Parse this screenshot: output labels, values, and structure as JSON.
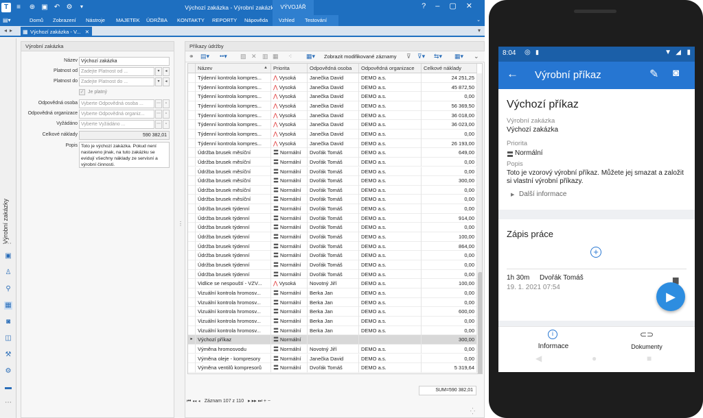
{
  "desktop": {
    "window_title": "Výchozí zakázka - Výrobní zakázka - TechIS",
    "context_tab": "VÝVOJÁŘ",
    "menu": [
      "Domů",
      "Zobrazení",
      "Nástroje",
      "MAJETEK",
      "ÚDRŽBA",
      "KONTAKTY",
      "REPORTY",
      "Nápověda",
      "Vzhled",
      "Testování"
    ],
    "document_tab": "Výchozí zakázka - V...",
    "left_rail_label": "Výrobní zakázky",
    "form": {
      "header": "Výrobní zakázka",
      "fields": {
        "nazev": {
          "label": "Název",
          "value": "Výchozí zakázka"
        },
        "platnost_od": {
          "label": "Platnost od",
          "placeholder": "Zadejte Platnost od ..."
        },
        "platnost_do": {
          "label": "Platnost do",
          "placeholder": "Zadejte Platnost do ..."
        },
        "je_platny": {
          "label": "Je platný"
        },
        "odp_osoba": {
          "label": "Odpovědná osoba",
          "placeholder": "Vyberte Odpovědná osoba ..."
        },
        "odp_org": {
          "label": "Odpovědná organizace",
          "placeholder": "Vyberte Odpovědná organiz..."
        },
        "vyzadano": {
          "label": "Vyžádáno",
          "placeholder": "Vyberte Vyžádáno ..."
        },
        "celkove": {
          "label": "Celkové náklady",
          "value": "590 382,01"
        },
        "popis": {
          "label": "Popis",
          "value": "Toto je výchozí zakázka. Pokud není nastaveno jinak, na tuto zakázku se evidují všechny náklady ze servisní a výrobní činnosti."
        }
      }
    },
    "grid": {
      "header": "Příkazy údržby",
      "toolbar_label": "Zobrazit modifikované záznamy",
      "columns": [
        "Název",
        "Priorita",
        "Odpovědná osoba",
        "Odpovědná organizace",
        "Celkové náklady"
      ],
      "rows": [
        [
          "Týdenní kontrola kompres...",
          "Vysoká",
          "Janečka David",
          "DEMO a.s.",
          "24 251,25"
        ],
        [
          "Týdenní kontrola kompres...",
          "Vysoká",
          "Janečka David",
          "DEMO a.s.",
          "45 872,50"
        ],
        [
          "Týdenní kontrola kompres...",
          "Vysoká",
          "Janečka David",
          "DEMO a.s.",
          "0,00"
        ],
        [
          "Týdenní kontrola kompres...",
          "Vysoká",
          "Janečka David",
          "DEMO a.s.",
          "56 369,50"
        ],
        [
          "Týdenní kontrola kompres...",
          "Vysoká",
          "Janečka David",
          "DEMO a.s.",
          "36 018,00"
        ],
        [
          "Týdenní kontrola kompres...",
          "Vysoká",
          "Janečka David",
          "DEMO a.s.",
          "36 023,00"
        ],
        [
          "Týdenní kontrola kompres...",
          "Vysoká",
          "Janečka David",
          "DEMO a.s.",
          "0,00"
        ],
        [
          "Týdenní kontrola kompres...",
          "Vysoká",
          "Janečka David",
          "DEMO a.s.",
          "26 193,00"
        ],
        [
          "Údržba brusek měsíční",
          "Normální",
          "Dvořák Tomáš",
          "DEMO a.s.",
          "649,00"
        ],
        [
          "Údržba brusek měsíční",
          "Normální",
          "Dvořák Tomáš",
          "DEMO a.s.",
          "0,00"
        ],
        [
          "Údržba brusek měsíční",
          "Normální",
          "Dvořák Tomáš",
          "DEMO a.s.",
          "0,00"
        ],
        [
          "Údržba brusek měsíční",
          "Normální",
          "Dvořák Tomáš",
          "DEMO a.s.",
          "300,00"
        ],
        [
          "Údržba brusek měsíční",
          "Normální",
          "Dvořák Tomáš",
          "DEMO a.s.",
          "0,00"
        ],
        [
          "Údržba brusek měsíční",
          "Normální",
          "Dvořák Tomáš",
          "DEMO a.s.",
          "0,00"
        ],
        [
          "Údržba brusek týdenní",
          "Normální",
          "Dvořák Tomáš",
          "DEMO a.s.",
          "0,00"
        ],
        [
          "Údržba brusek týdenní",
          "Normální",
          "Dvořák Tomáš",
          "DEMO a.s.",
          "914,00"
        ],
        [
          "Údržba brusek týdenní",
          "Normální",
          "Dvořák Tomáš",
          "DEMO a.s.",
          "0,00"
        ],
        [
          "Údržba brusek týdenní",
          "Normální",
          "Dvořák Tomáš",
          "DEMO a.s.",
          "100,00"
        ],
        [
          "Údržba brusek týdenní",
          "Normální",
          "Dvořák Tomáš",
          "DEMO a.s.",
          "864,00"
        ],
        [
          "Údržba brusek týdenní",
          "Normální",
          "Dvořák Tomáš",
          "DEMO a.s.",
          "0,00"
        ],
        [
          "Údržba brusek týdenní",
          "Normální",
          "Dvořák Tomáš",
          "DEMO a.s.",
          "0,00"
        ],
        [
          "Údržba brusek týdenní",
          "Normální",
          "Dvořák Tomáš",
          "DEMO a.s.",
          "0,00"
        ],
        [
          "Vidlice se nespouští - VZV...",
          "Vysoká",
          "Novotný Jiří",
          "DEMO a.s.",
          "100,00"
        ],
        [
          "Vizuální kontrola hromosv...",
          "Normální",
          "Berka Jan",
          "DEMO a.s.",
          "0,00"
        ],
        [
          "Vizuální kontrola hromosv...",
          "Normální",
          "Berka Jan",
          "DEMO a.s.",
          "0,00"
        ],
        [
          "Vizuální kontrola hromosv...",
          "Normální",
          "Berka Jan",
          "DEMO a.s.",
          "600,00"
        ],
        [
          "Vizuální kontrola hromosv...",
          "Normální",
          "Berka Jan",
          "DEMO a.s.",
          "0,00"
        ],
        [
          "Vizuální kontrola hromosv...",
          "Normální",
          "Berka Jan",
          "DEMO a.s.",
          "0,00"
        ],
        [
          "Výchozí příkaz",
          "Normální",
          "",
          "",
          "300,00"
        ],
        [
          "Výměna hromosvodu",
          "Normální",
          "Novotný Jiří",
          "DEMO a.s.",
          "0,00"
        ],
        [
          "Výměna oleje - kompresory",
          "Normální",
          "Janečka David",
          "DEMO a.s.",
          "0,00"
        ],
        [
          "Výměna ventilů kompresorů",
          "Normální",
          "Dvořák Tomáš",
          "DEMO a.s.",
          "5 319,64"
        ]
      ],
      "selected_row": 28,
      "sum": "SUM=590 382,01",
      "record_nav": "Záznam 107 z 110"
    }
  },
  "phone": {
    "status": {
      "time": "8:04"
    },
    "appbar_title": "Výrobní příkaz",
    "name": "Výchozí příkaz",
    "fields": [
      {
        "label": "Výrobní zakázka",
        "value": "Výchozí zakázka"
      },
      {
        "label": "Priorita",
        "value": "Normální"
      },
      {
        "label": "Popis",
        "value": "Toto je vzorový výrobní příkaz. Můžete jej smazat a založit si vlastní výrobní příkazy."
      }
    ],
    "more_info": "Další informace",
    "work_title": "Zápis práce",
    "work_entry": {
      "duration": "1h 30m",
      "person": "Dvořák Tomáš",
      "date": "19. 1. 2021 07:54"
    },
    "nav": {
      "info": "Informace",
      "docs": "Dokumenty"
    },
    "colors": {
      "appbar": "#2676d2",
      "status": "#1b5fa8",
      "fab": "#2d8de0"
    }
  }
}
